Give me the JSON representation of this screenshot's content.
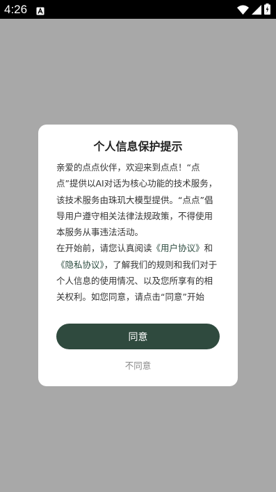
{
  "status_bar": {
    "time": "4:26",
    "icons": [
      "notification-a-icon",
      "wifi-icon",
      "signal-icon",
      "battery-charging-icon"
    ]
  },
  "dialog": {
    "title": "个人信息保护提示",
    "paragraph1": "亲爱的点点伙伴，欢迎来到点点！“点点”提供以AI对话为核心功能的技术服务，该技术服务由珠玑大模型提供。“点点”倡导用户遵守相关法律法规政策，不得使用本服务从事违法活动。",
    "paragraph2_prefix": "在开始前，请您认真阅读",
    "user_agreement_link": "《用户协议》",
    "paragraph2_and": "和",
    "privacy_agreement_link": "《隐私协议》",
    "paragraph2_suffix": "，了解我们的规则和我们对于个人信息的使用情况、以及您所享有的相关权利。如您同意，请点击“同意”开始",
    "agree_label": "同意",
    "disagree_label": "不同意"
  },
  "colors": {
    "overlay": "#a8a8a8",
    "accent": "#2f4a3e",
    "link": "#2e4d41"
  }
}
